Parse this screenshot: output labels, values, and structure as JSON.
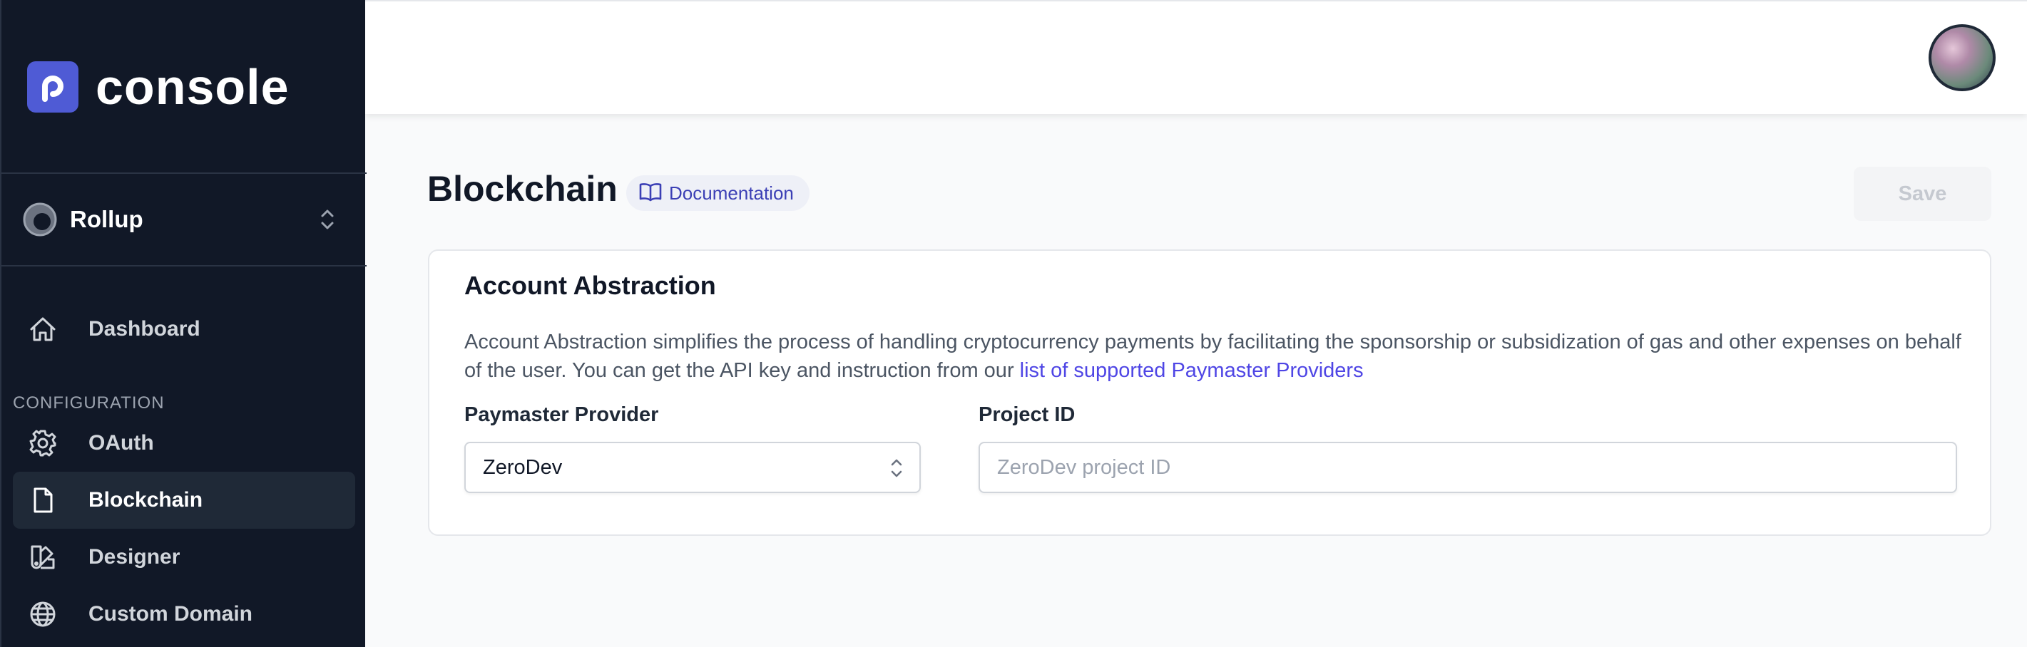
{
  "app": {
    "brand_name": "console",
    "accent_color": "#4f5bd5"
  },
  "sidebar": {
    "project": {
      "name": "Rollup",
      "chevron_icon": "chevron-up-down-icon"
    },
    "items": [
      {
        "label": "Dashboard",
        "icon": "home-icon",
        "active": false
      }
    ],
    "section_label": "CONFIGURATION",
    "config_items": [
      {
        "label": "OAuth",
        "icon": "gear-icon",
        "active": false
      },
      {
        "label": "Blockchain",
        "icon": "document-icon",
        "active": true
      },
      {
        "label": "Designer",
        "icon": "swatch-icon",
        "active": false
      },
      {
        "label": "Custom Domain",
        "icon": "globe-icon",
        "active": false
      }
    ]
  },
  "topbar": {
    "avatar_icon": "user-avatar"
  },
  "main": {
    "title": "Blockchain",
    "doc_link": {
      "label": "Documentation",
      "icon": "book-icon"
    },
    "save_label": "Save",
    "card": {
      "title": "Account Abstraction",
      "description_prefix": "Account Abstraction simplifies the process of handling cryptocurrency payments by facilitating the sponsorship or subsidization of gas and other expenses on behalf of the user. You can get the API key and instruction from our ",
      "description_link": "list of supported Paymaster Providers",
      "provider_field": {
        "label": "Paymaster Provider",
        "value": "ZeroDev"
      },
      "project_field": {
        "label": "Project ID",
        "value": "",
        "placeholder": "ZeroDev project ID"
      }
    }
  }
}
